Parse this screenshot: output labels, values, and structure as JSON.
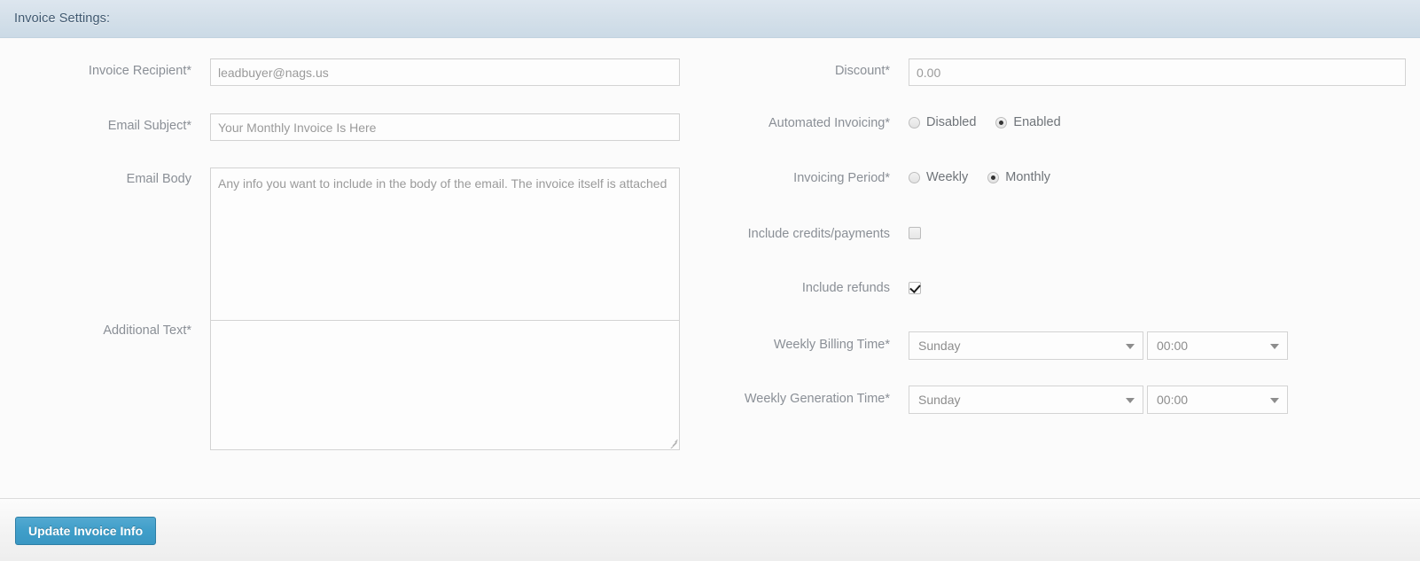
{
  "panel": {
    "title": "Invoice Settings:"
  },
  "left_column": {
    "invoice_recipient": {
      "label": "Invoice Recipient*",
      "value": "leadbuyer@nags.us"
    },
    "email_subject": {
      "label": "Email Subject*",
      "value": "Your Monthly Invoice Is Here"
    },
    "email_body": {
      "label": "Email Body",
      "value": "Any info you want to include in the body of the email. The invoice itself is attached"
    },
    "additional_text": {
      "label": "Additional Text*",
      "value": ""
    }
  },
  "right_column": {
    "discount": {
      "label": "Discount*",
      "value": "0.00"
    },
    "automated_invoicing": {
      "label": "Automated Invoicing*",
      "options": [
        "Disabled",
        "Enabled"
      ],
      "selected": "Enabled"
    },
    "invoicing_period": {
      "label": "Invoicing Period*",
      "options": [
        "Weekly",
        "Monthly"
      ],
      "selected": "Monthly"
    },
    "include_credits_payments": {
      "label": "Include credits/payments",
      "checked": false
    },
    "include_refunds": {
      "label": "Include refunds",
      "checked": true
    },
    "weekly_billing_time": {
      "label": "Weekly Billing Time*",
      "day": "Sunday",
      "time": "00:00"
    },
    "weekly_generation_time": {
      "label": "Weekly Generation Time*",
      "day": "Sunday",
      "time": "00:00"
    }
  },
  "footer": {
    "submit_label": "Update Invoice Info"
  },
  "colors": {
    "header_band": "#d3dfe9",
    "header_text": "#3f5870",
    "label_text": "#8a8f96",
    "input_text": "#9a9a9a",
    "primary_button": "#3f9ec9",
    "border": "#d3d3d3"
  }
}
